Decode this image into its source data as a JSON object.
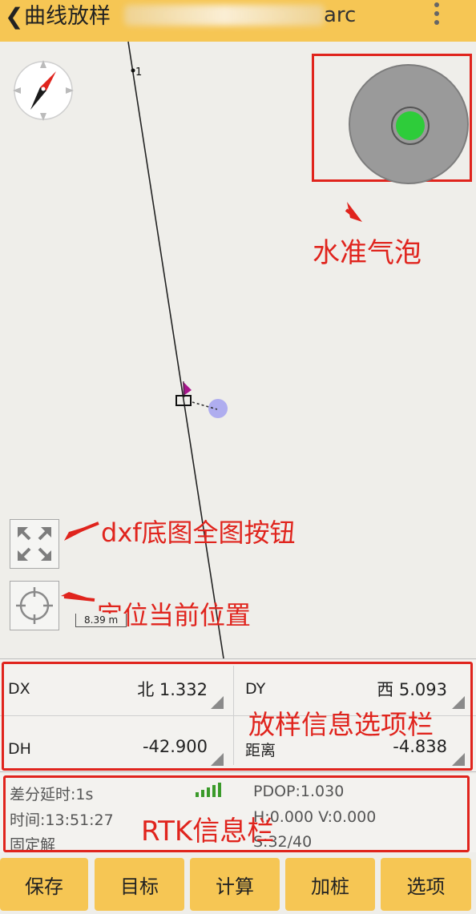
{
  "header": {
    "back_icon": "chevron-left-icon",
    "title_prefix": "曲线放样",
    "title_suffix": "arc",
    "menu_icon": "more-vertical-icon"
  },
  "map": {
    "point_label": "1",
    "scale_text": "8.39 m",
    "level_bubble_color": "#2ecc3a"
  },
  "annotations": {
    "level_bubble": "水准气泡",
    "full_map_button": "dxf底图全图按钮",
    "locate_button": "定位当前位置",
    "stakeout_bar": "放样信息选项栏",
    "rtk_bar": "RTK信息栏"
  },
  "stakeout": {
    "dx_label": "DX",
    "dx_value": "北 1.332",
    "dy_label": "DY",
    "dy_value": "西 5.093",
    "dh_label": "DH",
    "dh_value": "-42.900",
    "dist_label": "距离",
    "dist_value": "-4.838"
  },
  "rtk": {
    "diff_delay": "差分延时:1s",
    "time": "时间:13:51:27",
    "solution": "固定解",
    "pdop": "PDOP:1.030",
    "hv": "H:0.000  V:0.000",
    "sats": "S:32/40"
  },
  "buttons": {
    "save": "保存",
    "target": "目标",
    "calc": "计算",
    "add_stake": "加桩",
    "options": "选项"
  },
  "colors": {
    "accent": "#f6c654",
    "annotation": "#e0241d",
    "signal": "#3a9a2a"
  }
}
